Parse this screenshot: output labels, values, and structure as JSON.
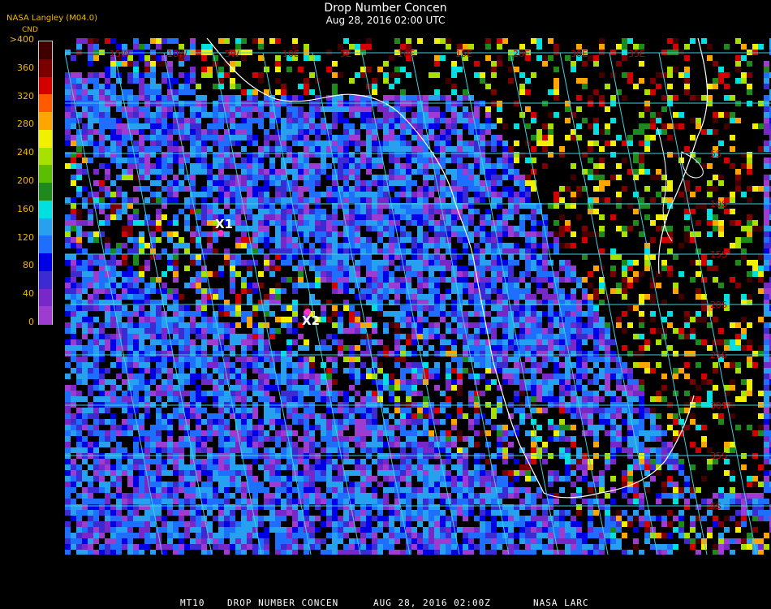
{
  "header": {
    "title": "Drop Number Concen",
    "datetime": "Aug 28, 2016 02:00 UTC",
    "source": "NASA Langley (M04.0)"
  },
  "colorbar": {
    "unit": "CND",
    "ticks": [
      ">400",
      "360",
      "320",
      "280",
      "240",
      "200",
      "160",
      "120",
      "80",
      "40",
      "0"
    ],
    "colors": [
      "#400000",
      "#7a0000",
      "#d40000",
      "#ff5a00",
      "#ffa500",
      "#f0f000",
      "#a8e000",
      "#5cbe00",
      "#1e8a1e",
      "#00e0e0",
      "#28a0f0",
      "#1e6eff",
      "#0000e6",
      "#3c2ad2",
      "#7828c8",
      "#9e3cd2"
    ]
  },
  "map": {
    "lon_labels": [
      "15W",
      "10W",
      "5W",
      "10E",
      "5E",
      "10E",
      "15E",
      "20E",
      "30E",
      "35E"
    ],
    "lat_labels": [
      "5S",
      "10S",
      "15S",
      "20S",
      "25S",
      "30S",
      "35S",
      "5S"
    ],
    "markers": [
      {
        "id": "X1",
        "label": "X1"
      },
      {
        "id": "X2",
        "label": "X2"
      }
    ],
    "grid_color": "#40d0e0",
    "coast_color": "#ffffff",
    "label_color": "#c00000"
  },
  "footer": {
    "product": "MT10",
    "field": "DROP NUMBER CONCEN",
    "time": "AUG 28, 2016 02:00Z",
    "agency": "NASA LARC"
  }
}
